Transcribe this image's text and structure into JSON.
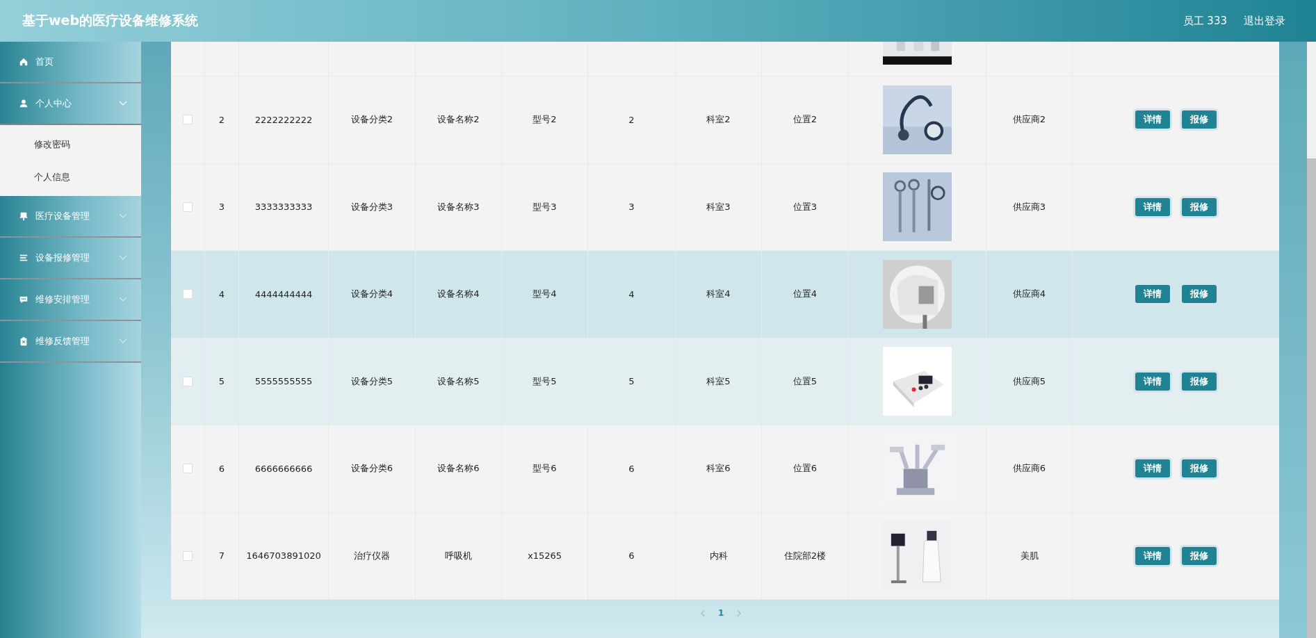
{
  "header": {
    "title": "基于web的医疗设备维修系统",
    "user": "员工 333",
    "logout": "退出登录"
  },
  "sidebar": {
    "items": [
      {
        "kind": "link",
        "label": "首页",
        "expanded": false
      },
      {
        "kind": "menu",
        "label": "个人中心",
        "expanded": true,
        "children": [
          {
            "label": "修改密码"
          },
          {
            "label": "个人信息"
          }
        ]
      },
      {
        "kind": "menu",
        "label": "医疗设备管理",
        "expanded": false
      },
      {
        "kind": "menu",
        "label": "设备报修管理",
        "expanded": false
      },
      {
        "kind": "menu",
        "label": "维修安排管理",
        "expanded": false
      },
      {
        "kind": "menu",
        "label": "维修反馈管理",
        "expanded": false
      }
    ]
  },
  "table": {
    "rows": [
      {
        "checked": false,
        "hovered": false,
        "light": false,
        "cells": [
          "2",
          "2222222222",
          "设备分类2",
          "设备名称2",
          "型号2",
          "2",
          "科室2",
          "位置2"
        ],
        "supplier": "供应商2",
        "actions": [
          "详情",
          "报修"
        ]
      },
      {
        "checked": false,
        "hovered": false,
        "light": false,
        "cells": [
          "3",
          "3333333333",
          "设备分类3",
          "设备名称3",
          "型号3",
          "3",
          "科室3",
          "位置3"
        ],
        "supplier": "供应商3",
        "actions": [
          "详情",
          "报修"
        ]
      },
      {
        "checked": false,
        "hovered": true,
        "light": false,
        "cells": [
          "4",
          "4444444444",
          "设备分类4",
          "设备名称4",
          "型号4",
          "4",
          "科室4",
          "位置4"
        ],
        "supplier": "供应商4",
        "actions": [
          "详情",
          "报修"
        ]
      },
      {
        "checked": false,
        "hovered": false,
        "light": true,
        "cells": [
          "5",
          "5555555555",
          "设备分类5",
          "设备名称5",
          "型号5",
          "5",
          "科室5",
          "位置5"
        ],
        "supplier": "供应商5",
        "actions": [
          "详情",
          "报修"
        ]
      },
      {
        "checked": false,
        "hovered": false,
        "light": false,
        "cells": [
          "6",
          "6666666666",
          "设备分类6",
          "设备名称6",
          "型号6",
          "6",
          "科室6",
          "位置6"
        ],
        "supplier": "供应商6",
        "actions": [
          "详情",
          "报修"
        ]
      },
      {
        "checked": false,
        "hovered": false,
        "light": false,
        "cells": [
          "7",
          "1646703891020",
          "治疗仪器",
          "呼吸机",
          "x15265",
          "6",
          "内科",
          "住院部2楼"
        ],
        "supplier": "美肌",
        "actions": [
          "详情",
          "报修"
        ]
      }
    ]
  },
  "pagination": {
    "pages": [
      {
        "label": "1",
        "selected": true
      }
    ]
  }
}
